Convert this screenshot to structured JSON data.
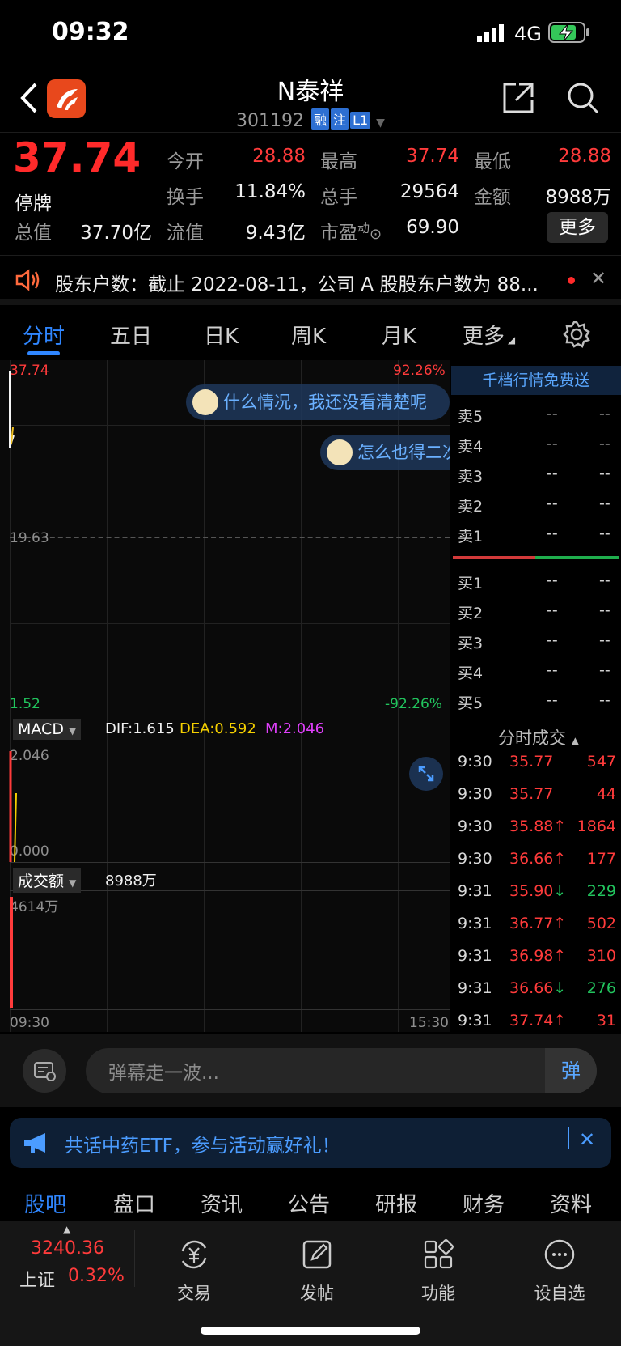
{
  "status_bar": {
    "time": "09:32",
    "network": "4G"
  },
  "header": {
    "stock_name": "N泰祥",
    "stock_code": "301192",
    "tags": [
      "融",
      "注",
      "L1"
    ]
  },
  "quote": {
    "price": "37.74",
    "status": "停牌",
    "open_label": "今开",
    "open": "28.88",
    "high_label": "最高",
    "high": "37.74",
    "low_label": "最低",
    "low": "28.88",
    "turnover_label": "换手",
    "turnover": "11.84%",
    "volume_label": "总手",
    "volume": "29564",
    "amount_label": "金额",
    "amount": "8988万",
    "mktcap_label": "总值",
    "mktcap": "37.70亿",
    "float_label": "流值",
    "float": "9.43亿",
    "pe_label": "市盈",
    "pe_sup": "动",
    "pe": "69.90",
    "more_label": "更多"
  },
  "news": {
    "text": "股东户数：截止 2022-08-11，公司 A 股股东户数为 88..."
  },
  "period_tabs": [
    "分时",
    "五日",
    "日K",
    "周K",
    "月K",
    "更多"
  ],
  "chart": {
    "price_top": "37.74",
    "pct_top": "92.26%",
    "price_mid": "19.63",
    "price_bottom": "1.52",
    "pct_bottom": "-92.26%",
    "danmaku": [
      "什么情况，我还没看清楚呢",
      "怎么也得二次"
    ],
    "macd_label": "MACD",
    "dif": "DIF:1.615",
    "dea": "DEA:0.592",
    "m": "M:2.046",
    "macd_top": "2.046",
    "macd_bottom": "0.000",
    "vol_label": "成交额",
    "vol_value": "8988万",
    "vol_top": "4614万",
    "time_start": "09:30",
    "time_end": "15:30"
  },
  "order_book": {
    "header": "千档行情免费送",
    "sells": [
      {
        "label": "卖5",
        "price": "--",
        "vol": "--"
      },
      {
        "label": "卖4",
        "price": "--",
        "vol": "--"
      },
      {
        "label": "卖3",
        "price": "--",
        "vol": "--"
      },
      {
        "label": "卖2",
        "price": "--",
        "vol": "--"
      },
      {
        "label": "卖1",
        "price": "--",
        "vol": "--"
      }
    ],
    "buys": [
      {
        "label": "买1",
        "price": "--",
        "vol": "--"
      },
      {
        "label": "买2",
        "price": "--",
        "vol": "--"
      },
      {
        "label": "买3",
        "price": "--",
        "vol": "--"
      },
      {
        "label": "买4",
        "price": "--",
        "vol": "--"
      },
      {
        "label": "买5",
        "price": "--",
        "vol": "--"
      }
    ]
  },
  "ticks": {
    "title": "分时成交",
    "rows": [
      {
        "time": "9:30",
        "price": "35.77",
        "vol": "547",
        "dir": "",
        "vol_color": "red"
      },
      {
        "time": "9:30",
        "price": "35.77",
        "vol": "44",
        "dir": "",
        "vol_color": "red"
      },
      {
        "time": "9:30",
        "price": "35.88",
        "vol": "1864",
        "dir": "↑",
        "vol_color": "red"
      },
      {
        "time": "9:30",
        "price": "36.66",
        "vol": "177",
        "dir": "↑",
        "vol_color": "red"
      },
      {
        "time": "9:31",
        "price": "35.90",
        "vol": "229",
        "dir": "↓",
        "vol_color": "green"
      },
      {
        "time": "9:31",
        "price": "36.77",
        "vol": "502",
        "dir": "↑",
        "vol_color": "red"
      },
      {
        "time": "9:31",
        "price": "36.98",
        "vol": "310",
        "dir": "↑",
        "vol_color": "red"
      },
      {
        "time": "9:31",
        "price": "36.66",
        "vol": "276",
        "dir": "↓",
        "vol_color": "green"
      },
      {
        "time": "9:31",
        "price": "37.74",
        "vol": "31",
        "dir": "↑",
        "vol_color": "red"
      }
    ]
  },
  "danmu_input": {
    "placeholder": "弹幕走一波...",
    "send_label": "弹"
  },
  "promo": {
    "text": "共话中药ETF，参与活动赢好礼！"
  },
  "bottom_tabs": [
    "股吧",
    "盘口",
    "资讯",
    "公告",
    "研报",
    "财务",
    "资料"
  ],
  "dock": {
    "index_value": "3240.36",
    "index_name": "上证",
    "index_pct": "0.32%",
    "items": [
      "交易",
      "发帖",
      "功能",
      "设自选"
    ]
  },
  "colors": {
    "up": "#ff3b3b",
    "down": "#22c55e",
    "accent": "#2f86ff"
  }
}
